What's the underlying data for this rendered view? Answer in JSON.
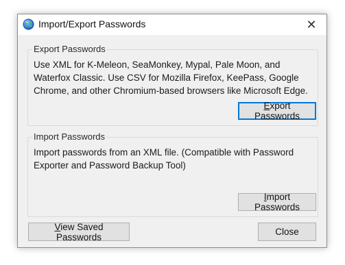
{
  "window": {
    "title": "Import/Export Passwords",
    "close_glyph": "✕",
    "icon": "globe-app-icon"
  },
  "export_group": {
    "legend": "Export Passwords",
    "description": "Use XML for K-Meleon, SeaMonkey, Mypal, Pale Moon, and Waterfox Classic. Use CSV for Mozilla Firefox, KeePass, Google Chrome, and other Chromium-based browsers like Microsoft Edge.",
    "button_label": "Export Passwords"
  },
  "import_group": {
    "legend": "Import Passwords",
    "description": "Import passwords from an XML file. (Compatible with Password Exporter and Password Backup Tool)",
    "button_label": "Import Passwords"
  },
  "footer": {
    "view_saved_label": "View Saved Passwords",
    "close_label": "Close"
  },
  "colors": {
    "focus_border": "#0078d7",
    "dialog_bg": "#f0f0f0",
    "button_bg": "#e1e1e1"
  }
}
